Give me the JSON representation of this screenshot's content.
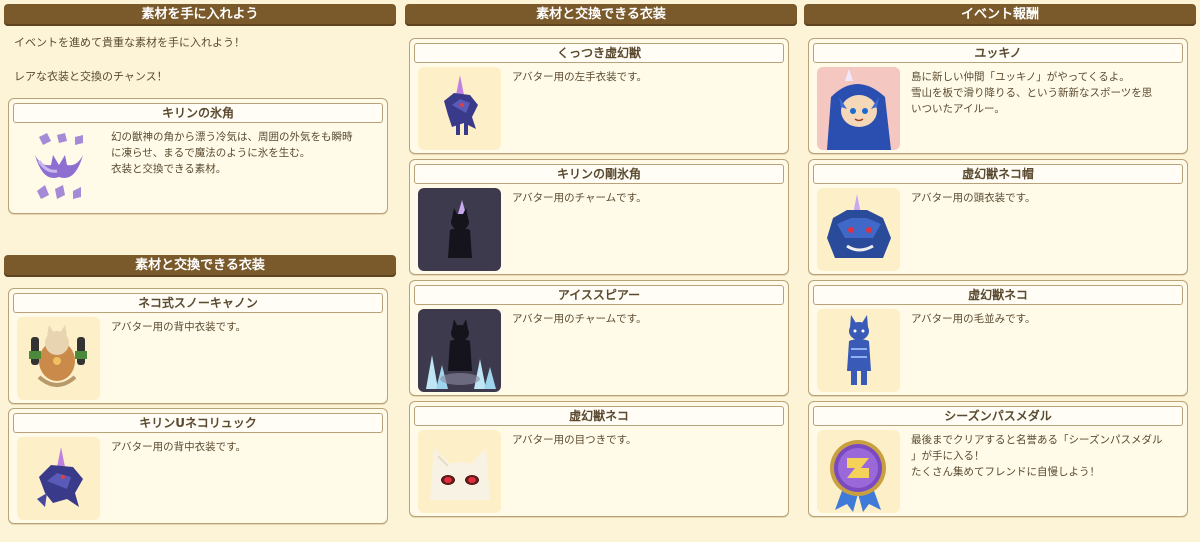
{
  "col1": {
    "header1": "素材を手に入れよう",
    "intro_line1": "イベントを進めて貴重な素材を手に入れよう！",
    "intro_line2": "レアな衣装と交換のチャンス！",
    "material": {
      "title": "キリンの氷角",
      "desc": "幻の獣神の角から漂う冷気は、周囲の外気をも瞬時\nに凍らせ、まるで魔法のように氷を生む。\n衣装と交換できる素材。",
      "icon": "ice-horn-icon"
    },
    "header2": "素材と交換できる衣装",
    "items": [
      {
        "title": "ネコ式スノーキャノン",
        "desc": "アバター用の背中衣装です。",
        "icon": "snow-cannon-icon"
      },
      {
        "title": "キリンUネコリュック",
        "desc": "アバター用の背中衣装です。",
        "icon": "kirin-backpack-icon"
      }
    ]
  },
  "col2": {
    "header": "素材と交換できる衣装",
    "items": [
      {
        "title": "くっつき虚幻獣",
        "desc": "アバター用の左手衣装です。",
        "icon": "kyogenju-icon"
      },
      {
        "title": "キリンの剛氷角",
        "desc": "アバター用のチャームです。",
        "icon": "ice-horn-charm-icon"
      },
      {
        "title": "アイススピアー",
        "desc": "アバター用のチャームです。",
        "icon": "ice-spear-icon"
      },
      {
        "title": "虚幻獣ネコ",
        "desc": "アバター用の目つきです。",
        "icon": "cat-eyes-icon"
      }
    ]
  },
  "col3": {
    "header": "イベント報酬",
    "items": [
      {
        "title": "ユッキノ",
        "desc": "島に新しい仲間「ユッキノ」がやってくるよ。\n雪山を板で滑り降りる、という新新なスポーツを思\nいついたアイルー。",
        "icon": "yukkino-icon"
      },
      {
        "title": "虚幻獣ネコ帽",
        "desc": "アバター用の頭衣装です。",
        "icon": "cat-hat-icon"
      },
      {
        "title": "虚幻獣ネコ",
        "desc": "アバター用の毛並みです。",
        "icon": "cat-fur-icon"
      },
      {
        "title": "シーズンパスメダル",
        "desc": "最後までクリアすると名誉ある「シーズンパスメダル\n」が手に入る！\nたくさん集めてフレンドに自慢しよう！",
        "icon": "medal-icon"
      }
    ]
  },
  "colors": {
    "header_bg": "#7a5a2b",
    "page_bg": "#fdf3d6",
    "card_bg": "#fffbe8"
  }
}
